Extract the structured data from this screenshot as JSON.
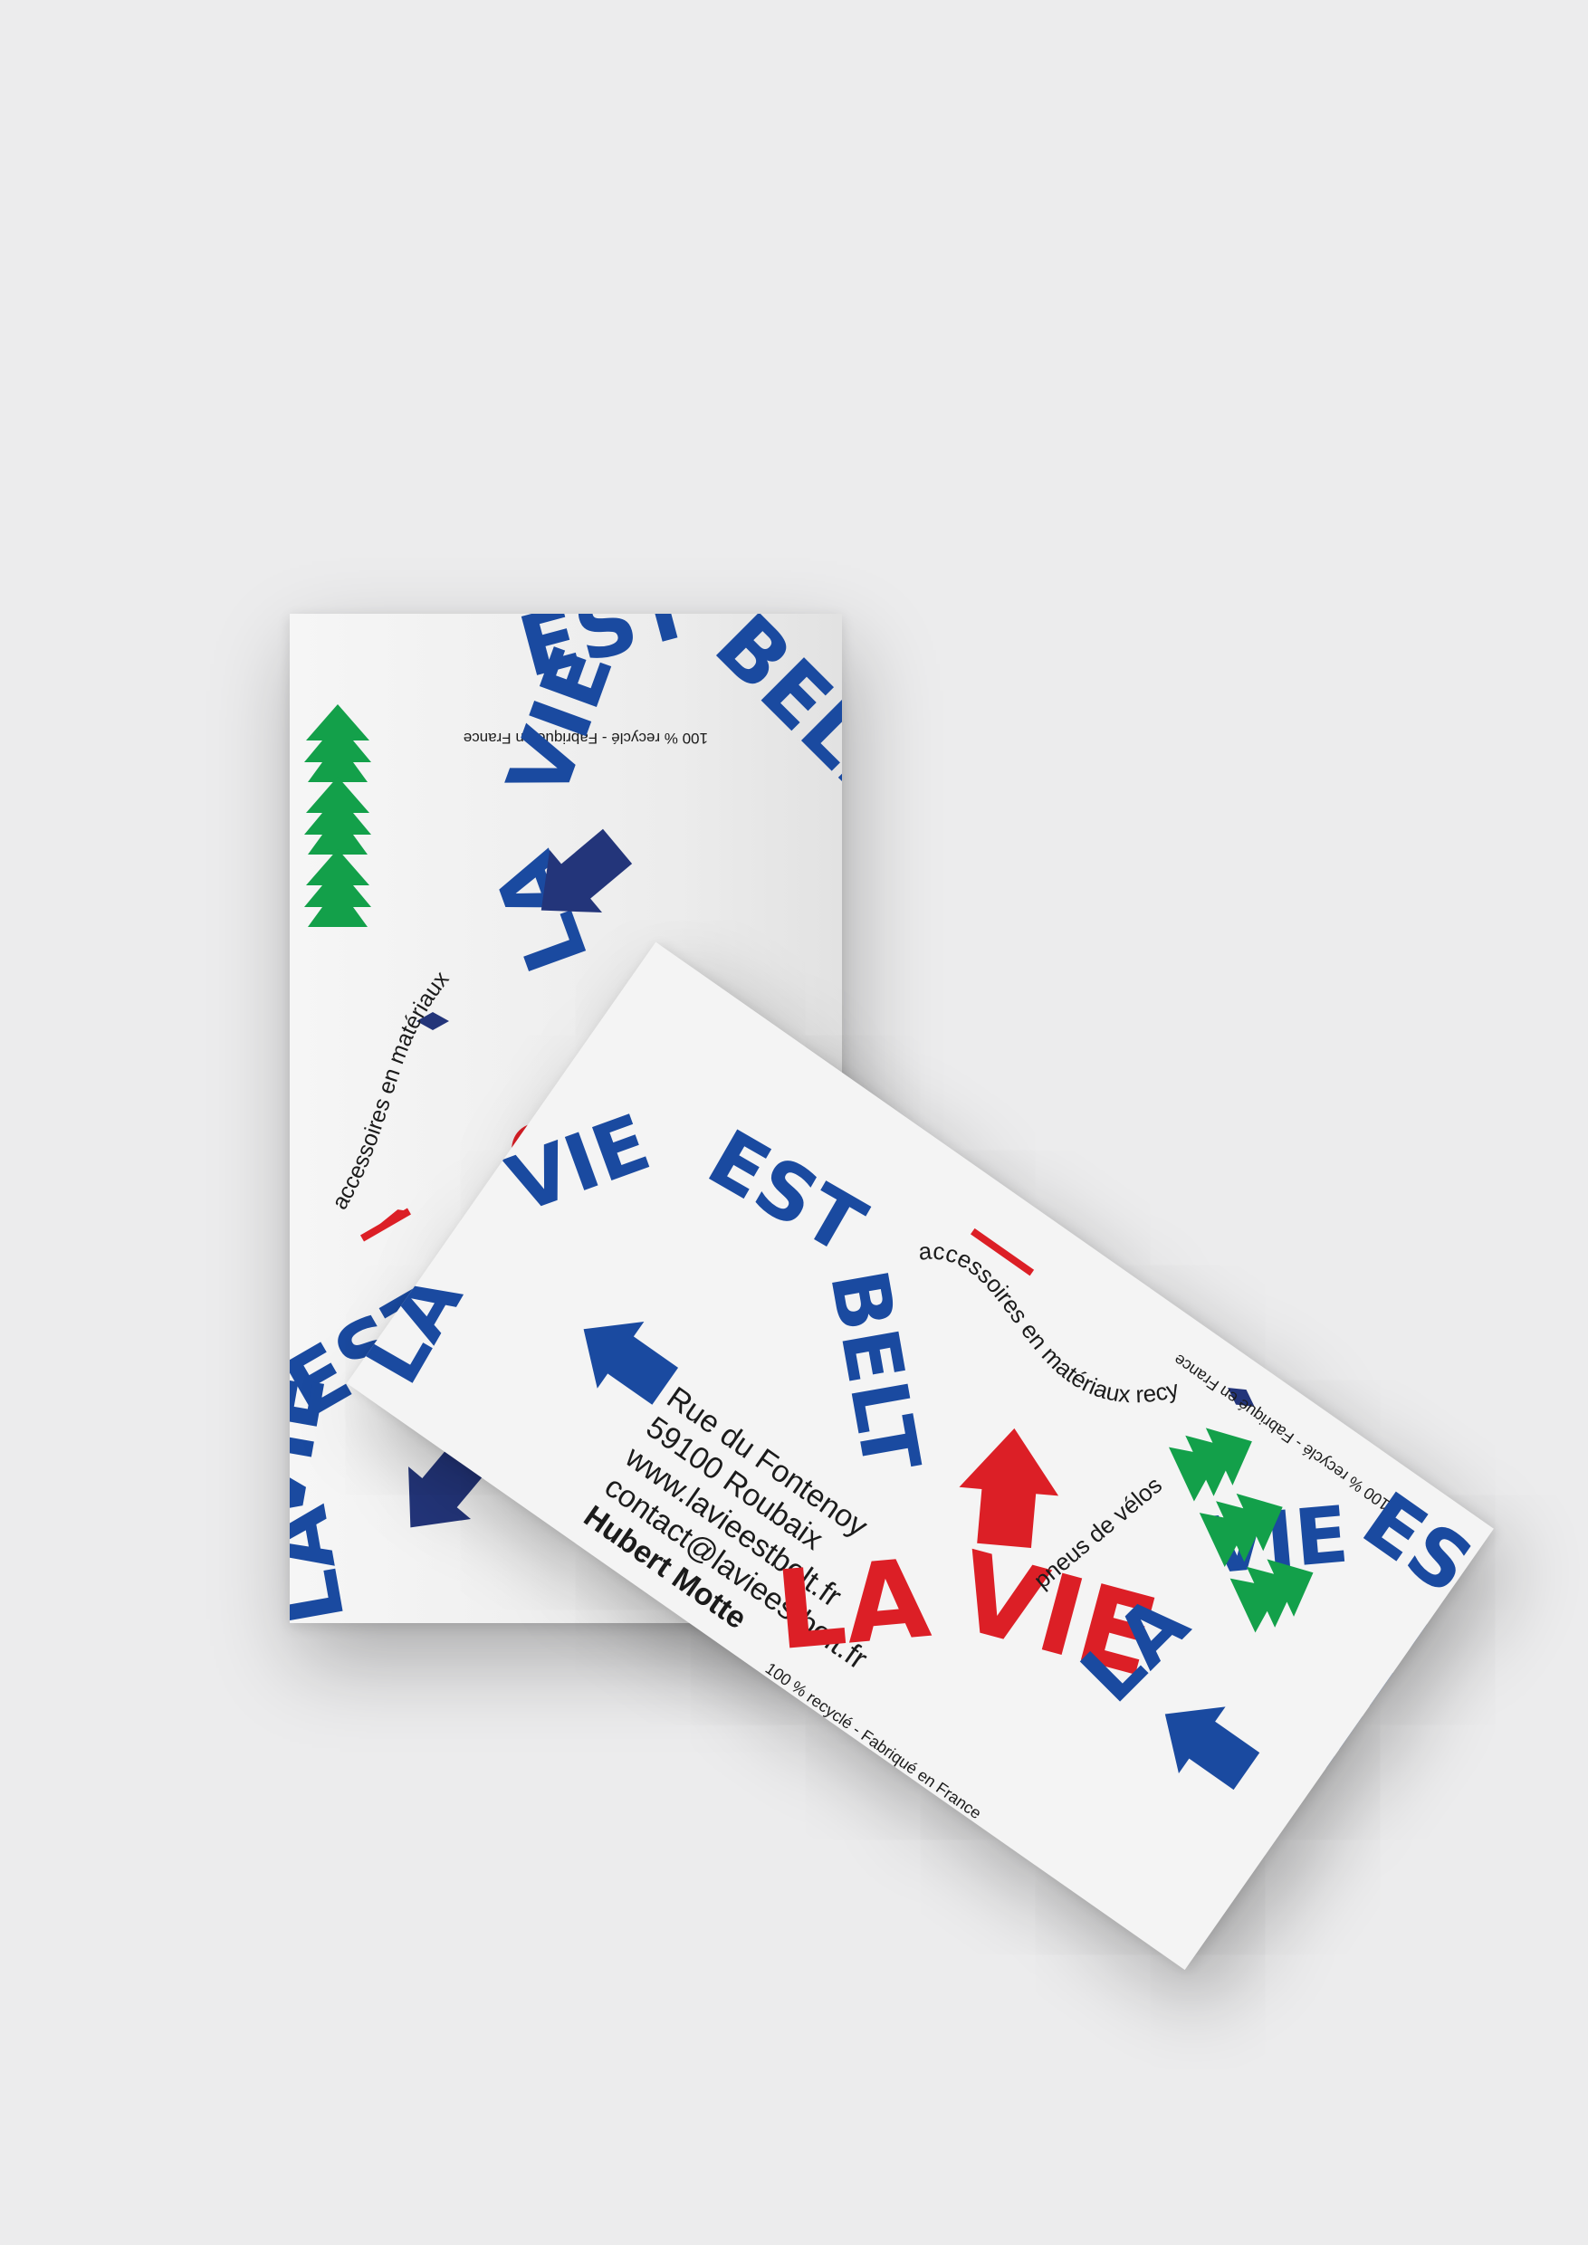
{
  "colors": {
    "background": "#ececed",
    "card": "#f4f4f4",
    "blue": "#1a4aa0",
    "navy": "#23357a",
    "red": "#dc1f26",
    "green": "#13a04a",
    "text": "#1b1b1b"
  },
  "brand": {
    "line1": "LA VIE",
    "line2": "EST",
    "line3": "BELT",
    "wordmark_la": "LA",
    "wordmark_vie": "VIE"
  },
  "tagline": {
    "main": "accessoires en matériaux recyclés",
    "secondary": "pneus de vélos",
    "footer": "100 % recyclé - Fabriqué en France"
  },
  "contact": {
    "street": "Rue du Fontenoy",
    "city": "59100 Roubaix",
    "website": "www.lavieestbelt.fr",
    "email": "contact@lavieestbelt.fr",
    "name": "Hubert Motte"
  },
  "back_card": {
    "top_footer": "100 % recyclé - Fabriqué en France",
    "tagline": "accessoires en matériaux recyclés",
    "fragment": "s"
  },
  "icons": {
    "arrow": "arrow-icon",
    "tree": "tree-icon",
    "bowtie": "bowtie-icon"
  }
}
